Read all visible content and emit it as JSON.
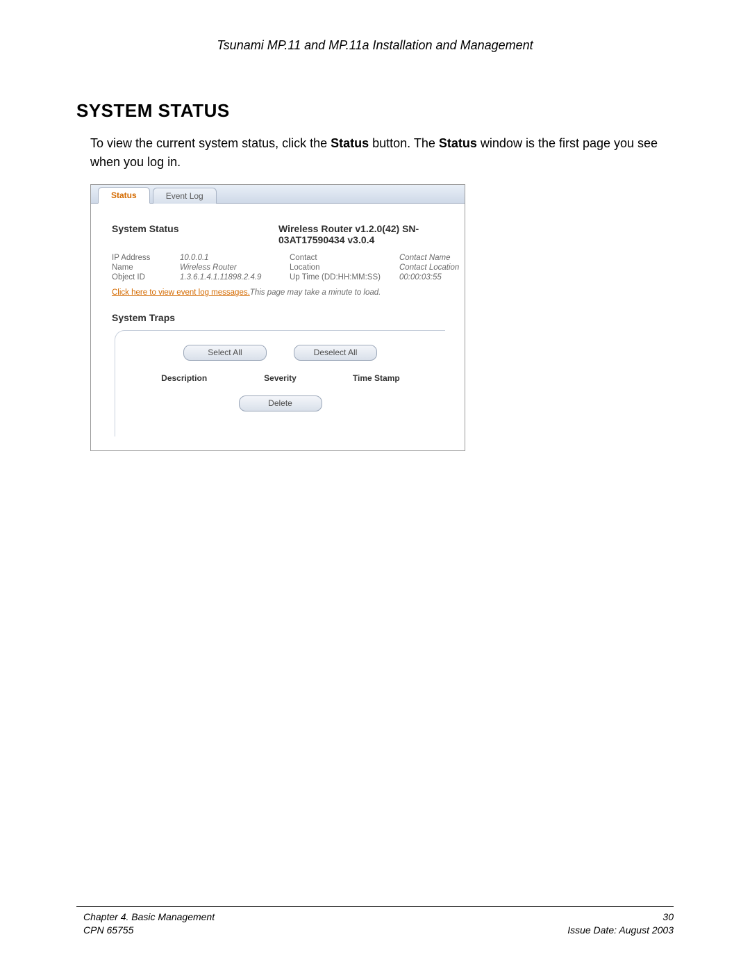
{
  "doc": {
    "header": "Tsunami MP.11 and MP.11a Installation and Management",
    "section_heading": "SYSTEM STATUS",
    "body_prefix": "To view the current system status, click the ",
    "body_bold1": "Status",
    "body_mid": " button.  The ",
    "body_bold2": "Status",
    "body_suffix": " window is the first page you see when you log in."
  },
  "shot": {
    "tabs": {
      "status": "Status",
      "eventlog": "Event Log"
    },
    "status_title": "System Status",
    "status_version": "Wireless Router v1.2.0(42) SN-03AT17590434 v3.0.4",
    "rows": {
      "ip_label": "IP Address",
      "ip_value": "10.0.0.1",
      "name_label": "Name",
      "name_value": "Wireless Router",
      "obj_label": "Object ID",
      "obj_value": "1.3.6.1.4.1.11898.2.4.9",
      "contact_label": "Contact",
      "contact_value": "Contact Name",
      "location_label": "Location",
      "location_value": "Contact Location",
      "uptime_label": "Up Time (DD:HH:MM:SS)",
      "uptime_value": "00:00:03:55"
    },
    "event_link": "Click here to view event log messages.",
    "event_note": "This page may take a minute to load.",
    "traps_title": "System Traps",
    "btn_select_all": "Select All",
    "btn_deselect_all": "Deselect All",
    "btn_delete": "Delete",
    "col_desc": "Description",
    "col_sev": "Severity",
    "col_time": "Time Stamp"
  },
  "footer": {
    "chapter": "Chapter 4.  Basic Management",
    "cpn": "CPN 65755",
    "page": "30",
    "issue": "Issue Date:  August 2003"
  }
}
